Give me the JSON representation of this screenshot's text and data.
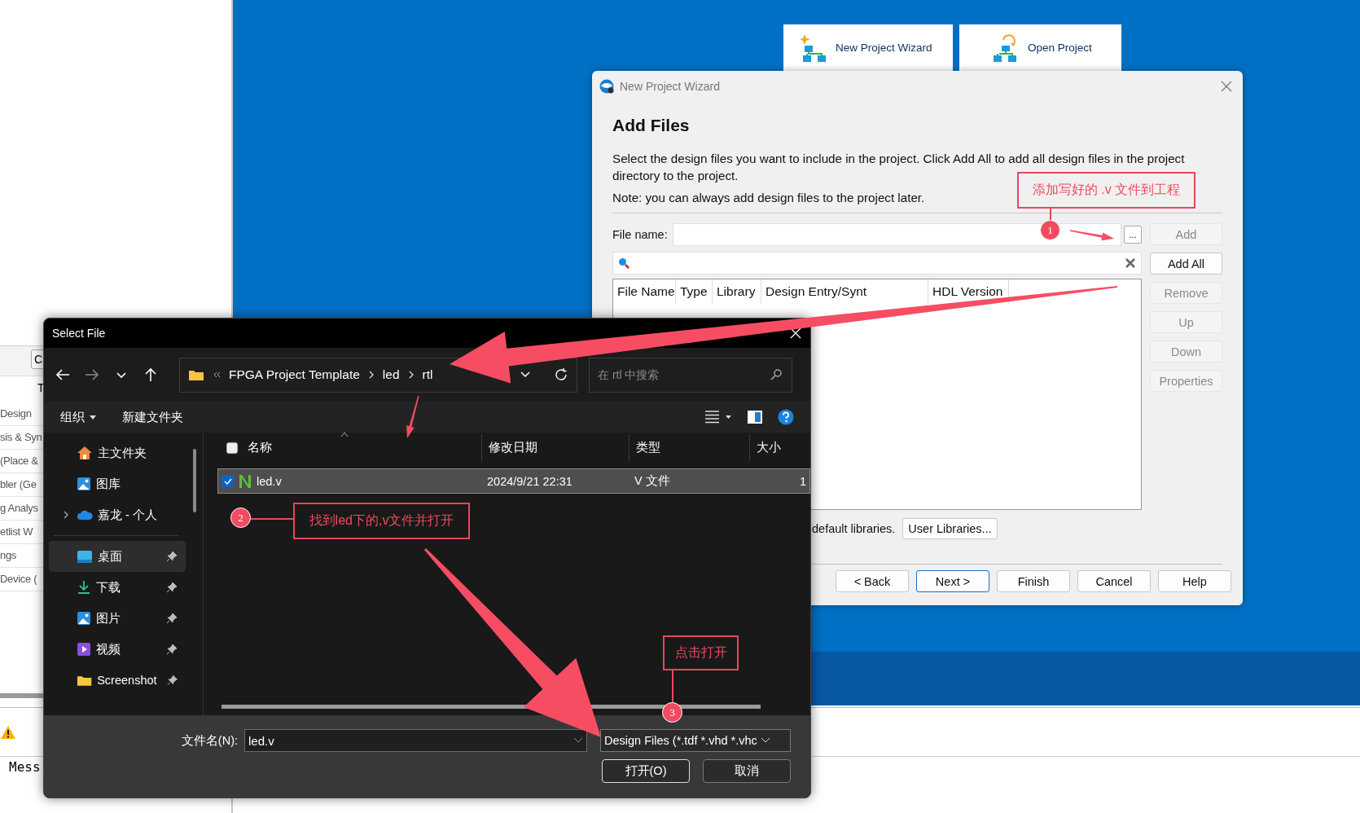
{
  "background_window": {
    "left_panel": {
      "button_label": "C",
      "column_label": "T",
      "items": [
        "Design",
        "sis & Syn",
        "(Place &",
        "bler (Ge",
        "g Analys",
        "etlist W",
        "ngs",
        "Device ("
      ]
    },
    "messages_label": "Mess"
  },
  "start_buttons": [
    {
      "label": "New Project Wizard",
      "kind": "new"
    },
    {
      "label": "Open Project",
      "kind": "open"
    }
  ],
  "wizard": {
    "title": "New Project Wizard",
    "heading": "Add Files",
    "description": "Select the design files you want to include in the project. Click Add All to add all design files in the project directory to the project.",
    "note": "Note: you can always add design files to the project later.",
    "file_name_label": "File name:",
    "browse_button": "...",
    "columns": [
      "File Name",
      "Type",
      "Library",
      "Design Entry/Synt",
      "HDL Version"
    ],
    "side_buttons": [
      {
        "label": "Add",
        "disabled": true
      },
      {
        "label": "Add All",
        "disabled": false
      },
      {
        "label": "Remove",
        "disabled": true
      },
      {
        "label": "Up",
        "disabled": true
      },
      {
        "label": "Down",
        "disabled": true
      },
      {
        "label": "Properties",
        "disabled": true
      }
    ],
    "libraries_text": "default libraries.",
    "user_libraries_button": "User Libraries...",
    "nav_buttons": [
      {
        "label": "< Back",
        "default": false
      },
      {
        "label": "Next >",
        "default": true
      },
      {
        "label": "Finish",
        "default": false
      },
      {
        "label": "Cancel",
        "default": false
      },
      {
        "label": "Help",
        "default": false
      }
    ]
  },
  "file_dialog": {
    "title": "Select File",
    "path": [
      "FPGA Project Template",
      "led",
      "rtl"
    ],
    "search_placeholder": "在 rtl 中搜索",
    "toolbar": [
      "组织",
      "新建文件夹"
    ],
    "sidebar": [
      {
        "label": "主文件夹",
        "kind": "home",
        "selected": false,
        "pinned": false,
        "expandable": false
      },
      {
        "label": "图库",
        "kind": "gallery",
        "selected": false,
        "pinned": false,
        "expandable": false
      },
      {
        "label": "嘉龙 - 个人",
        "kind": "cloud",
        "selected": false,
        "pinned": false,
        "expandable": true
      },
      {
        "kind": "divider"
      },
      {
        "label": "桌面",
        "kind": "desktop",
        "selected": true,
        "pinned": true,
        "expandable": false
      },
      {
        "label": "下载",
        "kind": "download",
        "selected": false,
        "pinned": true,
        "expandable": false
      },
      {
        "label": "图片",
        "kind": "pictures",
        "selected": false,
        "pinned": true,
        "expandable": false
      },
      {
        "label": "视频",
        "kind": "videos",
        "selected": false,
        "pinned": true,
        "expandable": false
      },
      {
        "label": "Screenshot",
        "kind": "folder",
        "selected": false,
        "pinned": true,
        "expandable": false
      }
    ],
    "select_all_checked": false,
    "columns": [
      "名称",
      "修改日期",
      "类型",
      "大小"
    ],
    "files": [
      {
        "name": "led.v",
        "date": "2024/9/21 22:31",
        "type": "V 文件",
        "size": "1",
        "selected": true,
        "checked": true
      }
    ],
    "file_name_label": "文件名(N):",
    "file_name_value": "led.v",
    "filter": "Design Files (*.tdf *.vhd *.vhc",
    "buttons": [
      "打开(O)",
      "取消"
    ]
  },
  "annotations": [
    {
      "number": "1",
      "text": "添加写好的 .v 文件到工程"
    },
    {
      "number": "2",
      "text": "找到led下的,v文件并打开"
    },
    {
      "number": "3",
      "text": "点击打开"
    }
  ]
}
